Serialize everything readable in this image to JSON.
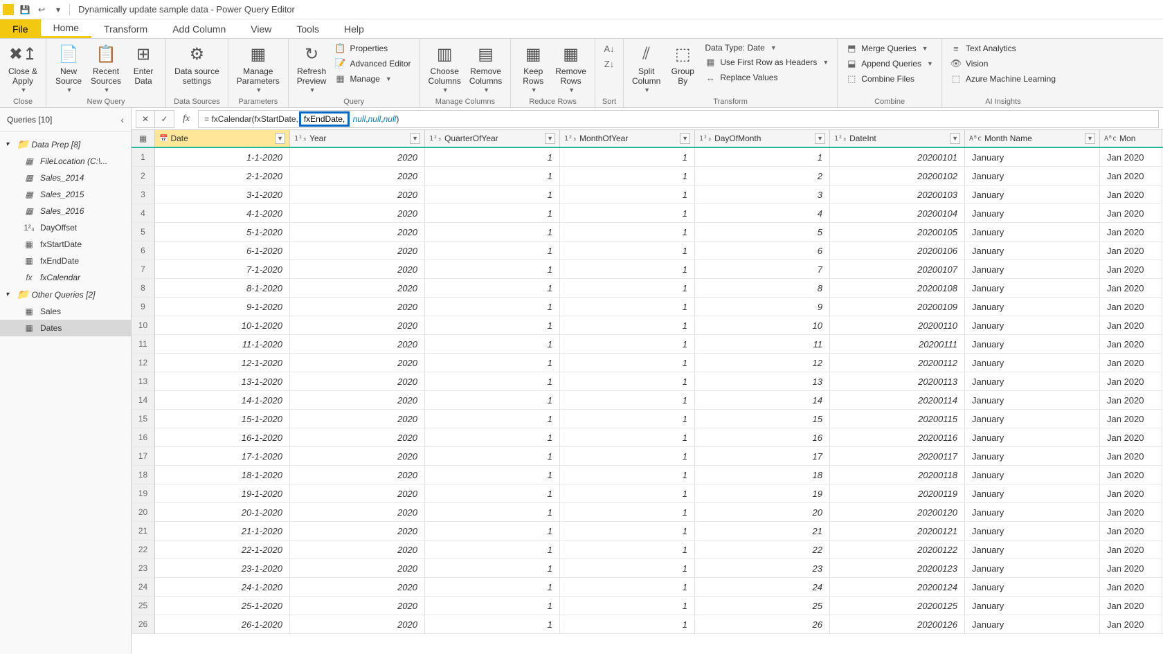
{
  "title": "Dynamically update sample data - Power Query Editor",
  "menuTabs": {
    "file": "File",
    "home": "Home",
    "transform": "Transform",
    "addColumn": "Add Column",
    "view": "View",
    "tools": "Tools",
    "help": "Help"
  },
  "ribbon": {
    "close": {
      "closeApply": "Close &\nApply",
      "group": "Close"
    },
    "newQuery": {
      "newSource": "New\nSource",
      "recentSources": "Recent\nSources",
      "enterData": "Enter\nData",
      "group": "New Query"
    },
    "dataSources": {
      "settings": "Data source\nsettings",
      "group": "Data Sources"
    },
    "parameters": {
      "manage": "Manage\nParameters",
      "group": "Parameters"
    },
    "query": {
      "refresh": "Refresh\nPreview",
      "properties": "Properties",
      "advanced": "Advanced Editor",
      "manage": "Manage",
      "group": "Query"
    },
    "manageColumns": {
      "choose": "Choose\nColumns",
      "remove": "Remove\nColumns",
      "group": "Manage Columns"
    },
    "reduceRows": {
      "keep": "Keep\nRows",
      "remove": "Remove\nRows",
      "group": "Reduce Rows"
    },
    "sort": {
      "group": "Sort"
    },
    "transform": {
      "split": "Split\nColumn",
      "groupBy": "Group\nBy",
      "dataType": "Data Type: Date",
      "firstRow": "Use First Row as Headers",
      "replace": "Replace Values",
      "group": "Transform"
    },
    "combine": {
      "merge": "Merge Queries",
      "append": "Append Queries",
      "combineFiles": "Combine Files",
      "group": "Combine"
    },
    "aiInsights": {
      "text": "Text Analytics",
      "vision": "Vision",
      "ml": "Azure Machine Learning",
      "group": "AI Insights"
    }
  },
  "queriesPanel": {
    "header": "Queries [10]",
    "folder1": "Data Prep [8]",
    "items1": [
      {
        "icon": "table",
        "label": "FileLocation (C:\\...",
        "italic": true
      },
      {
        "icon": "table",
        "label": "Sales_2014",
        "italic": true
      },
      {
        "icon": "table",
        "label": "Sales_2015",
        "italic": true
      },
      {
        "icon": "table",
        "label": "Sales_2016",
        "italic": true
      },
      {
        "icon": "num",
        "label": "DayOffset",
        "italic": false
      },
      {
        "icon": "table",
        "label": "fxStartDate",
        "italic": false
      },
      {
        "icon": "table",
        "label": "fxEndDate",
        "italic": false
      },
      {
        "icon": "fx",
        "label": "fxCalendar",
        "italic": true
      }
    ],
    "folder2": "Other Queries [2]",
    "items2": [
      {
        "icon": "table",
        "label": "Sales"
      },
      {
        "icon": "table",
        "label": "Dates"
      }
    ]
  },
  "formula": {
    "prefix": "= fxCalendar(fxStartDate, ",
    "highlight": "fxEndDate,",
    "null1": "null",
    "c1": ", ",
    "null2": "null",
    "c2": ", ",
    "null3": "null",
    "suffix": ")"
  },
  "columns": [
    {
      "key": "date",
      "type": "📅",
      "label": "Date",
      "cls": "col-date",
      "selected": true,
      "render": "date"
    },
    {
      "key": "year",
      "type": "1²₃",
      "label": "Year",
      "cls": "col-year",
      "render": "num"
    },
    {
      "key": "qoy",
      "type": "1²₃",
      "label": "QuarterOfYear",
      "cls": "col-qoy",
      "render": "num"
    },
    {
      "key": "moy",
      "type": "1²₃",
      "label": "MonthOfYear",
      "cls": "col-moy",
      "render": "num"
    },
    {
      "key": "dom",
      "type": "1²₃",
      "label": "DayOfMonth",
      "cls": "col-dom",
      "render": "num"
    },
    {
      "key": "dateint",
      "type": "1²₃",
      "label": "DateInt",
      "cls": "col-dateint",
      "render": "num"
    },
    {
      "key": "mname",
      "type": "Aᴮc",
      "label": "Month Name",
      "cls": "col-mname",
      "render": "txt"
    },
    {
      "key": "mon",
      "type": "Aᴮc",
      "label": "Mon",
      "cls": "col-mon",
      "render": "txt",
      "noFilter": true
    }
  ],
  "rows": [
    {
      "date": "1-1-2020",
      "year": "2020",
      "qoy": "1",
      "moy": "1",
      "dom": "1",
      "dateint": "20200101",
      "mname": "January",
      "mon": "Jan 2020"
    },
    {
      "date": "2-1-2020",
      "year": "2020",
      "qoy": "1",
      "moy": "1",
      "dom": "2",
      "dateint": "20200102",
      "mname": "January",
      "mon": "Jan 2020"
    },
    {
      "date": "3-1-2020",
      "year": "2020",
      "qoy": "1",
      "moy": "1",
      "dom": "3",
      "dateint": "20200103",
      "mname": "January",
      "mon": "Jan 2020"
    },
    {
      "date": "4-1-2020",
      "year": "2020",
      "qoy": "1",
      "moy": "1",
      "dom": "4",
      "dateint": "20200104",
      "mname": "January",
      "mon": "Jan 2020"
    },
    {
      "date": "5-1-2020",
      "year": "2020",
      "qoy": "1",
      "moy": "1",
      "dom": "5",
      "dateint": "20200105",
      "mname": "January",
      "mon": "Jan 2020"
    },
    {
      "date": "6-1-2020",
      "year": "2020",
      "qoy": "1",
      "moy": "1",
      "dom": "6",
      "dateint": "20200106",
      "mname": "January",
      "mon": "Jan 2020"
    },
    {
      "date": "7-1-2020",
      "year": "2020",
      "qoy": "1",
      "moy": "1",
      "dom": "7",
      "dateint": "20200107",
      "mname": "January",
      "mon": "Jan 2020"
    },
    {
      "date": "8-1-2020",
      "year": "2020",
      "qoy": "1",
      "moy": "1",
      "dom": "8",
      "dateint": "20200108",
      "mname": "January",
      "mon": "Jan 2020"
    },
    {
      "date": "9-1-2020",
      "year": "2020",
      "qoy": "1",
      "moy": "1",
      "dom": "9",
      "dateint": "20200109",
      "mname": "January",
      "mon": "Jan 2020"
    },
    {
      "date": "10-1-2020",
      "year": "2020",
      "qoy": "1",
      "moy": "1",
      "dom": "10",
      "dateint": "20200110",
      "mname": "January",
      "mon": "Jan 2020"
    },
    {
      "date": "11-1-2020",
      "year": "2020",
      "qoy": "1",
      "moy": "1",
      "dom": "11",
      "dateint": "20200111",
      "mname": "January",
      "mon": "Jan 2020"
    },
    {
      "date": "12-1-2020",
      "year": "2020",
      "qoy": "1",
      "moy": "1",
      "dom": "12",
      "dateint": "20200112",
      "mname": "January",
      "mon": "Jan 2020"
    },
    {
      "date": "13-1-2020",
      "year": "2020",
      "qoy": "1",
      "moy": "1",
      "dom": "13",
      "dateint": "20200113",
      "mname": "January",
      "mon": "Jan 2020"
    },
    {
      "date": "14-1-2020",
      "year": "2020",
      "qoy": "1",
      "moy": "1",
      "dom": "14",
      "dateint": "20200114",
      "mname": "January",
      "mon": "Jan 2020"
    },
    {
      "date": "15-1-2020",
      "year": "2020",
      "qoy": "1",
      "moy": "1",
      "dom": "15",
      "dateint": "20200115",
      "mname": "January",
      "mon": "Jan 2020"
    },
    {
      "date": "16-1-2020",
      "year": "2020",
      "qoy": "1",
      "moy": "1",
      "dom": "16",
      "dateint": "20200116",
      "mname": "January",
      "mon": "Jan 2020"
    },
    {
      "date": "17-1-2020",
      "year": "2020",
      "qoy": "1",
      "moy": "1",
      "dom": "17",
      "dateint": "20200117",
      "mname": "January",
      "mon": "Jan 2020"
    },
    {
      "date": "18-1-2020",
      "year": "2020",
      "qoy": "1",
      "moy": "1",
      "dom": "18",
      "dateint": "20200118",
      "mname": "January",
      "mon": "Jan 2020"
    },
    {
      "date": "19-1-2020",
      "year": "2020",
      "qoy": "1",
      "moy": "1",
      "dom": "19",
      "dateint": "20200119",
      "mname": "January",
      "mon": "Jan 2020"
    },
    {
      "date": "20-1-2020",
      "year": "2020",
      "qoy": "1",
      "moy": "1",
      "dom": "20",
      "dateint": "20200120",
      "mname": "January",
      "mon": "Jan 2020"
    },
    {
      "date": "21-1-2020",
      "year": "2020",
      "qoy": "1",
      "moy": "1",
      "dom": "21",
      "dateint": "20200121",
      "mname": "January",
      "mon": "Jan 2020"
    },
    {
      "date": "22-1-2020",
      "year": "2020",
      "qoy": "1",
      "moy": "1",
      "dom": "22",
      "dateint": "20200122",
      "mname": "January",
      "mon": "Jan 2020"
    },
    {
      "date": "23-1-2020",
      "year": "2020",
      "qoy": "1",
      "moy": "1",
      "dom": "23",
      "dateint": "20200123",
      "mname": "January",
      "mon": "Jan 2020"
    },
    {
      "date": "24-1-2020",
      "year": "2020",
      "qoy": "1",
      "moy": "1",
      "dom": "24",
      "dateint": "20200124",
      "mname": "January",
      "mon": "Jan 2020"
    },
    {
      "date": "25-1-2020",
      "year": "2020",
      "qoy": "1",
      "moy": "1",
      "dom": "25",
      "dateint": "20200125",
      "mname": "January",
      "mon": "Jan 2020"
    },
    {
      "date": "26-1-2020",
      "year": "2020",
      "qoy": "1",
      "moy": "1",
      "dom": "26",
      "dateint": "20200126",
      "mname": "January",
      "mon": "Jan 2020"
    }
  ]
}
